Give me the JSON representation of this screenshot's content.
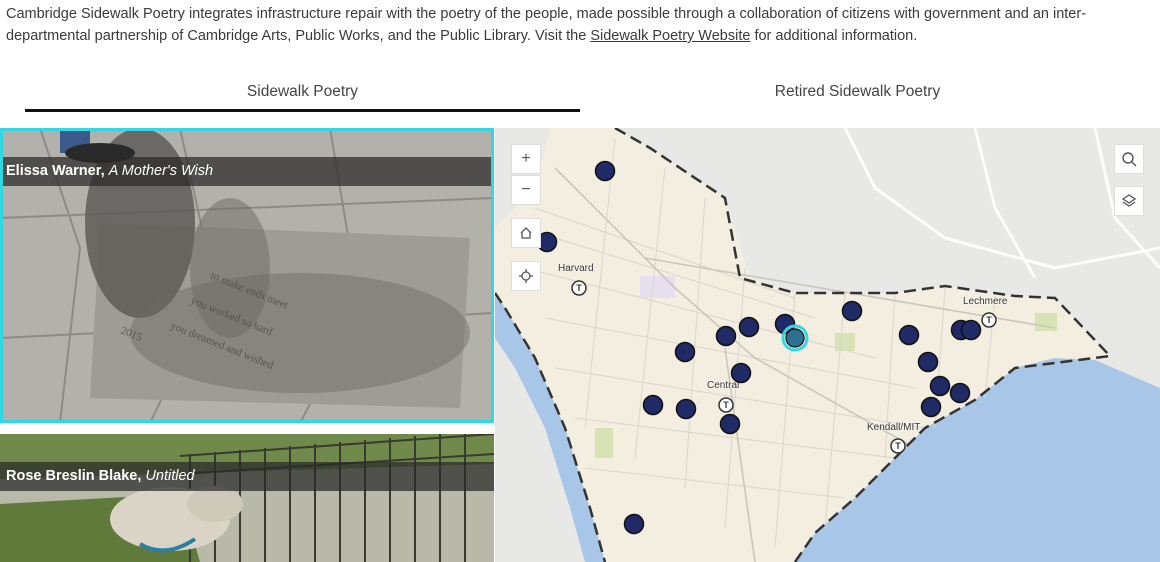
{
  "intro": {
    "text_before": "Cambridge Sidewalk Poetry integrates infrastructure repair with the poetry of the people, made possible through a collaboration of citizens with government and an inter-departmental partnership of Cambridge Arts, Public Works, and the Public Library. Visit the ",
    "link_text": "Sidewalk Poetry Website",
    "text_after": " for additional information."
  },
  "tabs": [
    {
      "label": "Sidewalk Poetry",
      "active": true
    },
    {
      "label": "Retired Sidewalk Poetry",
      "active": false
    }
  ],
  "cards": [
    {
      "author": "Elissa Warner,",
      "title": "A Mother's Wish",
      "selected": true
    },
    {
      "author": "Rose Breslin Blake,",
      "title": "Untitled",
      "selected": false
    }
  ],
  "map": {
    "controls": {
      "zoom_in": "+",
      "zoom_out": "−",
      "home": "home-icon",
      "locate": "locate-icon",
      "search": "search-icon",
      "layers": "layers-icon"
    },
    "labels": {
      "harvard": "Harvard",
      "central": "Central",
      "kendall": "Kendall/MIT",
      "lechmere": "Lechmere"
    },
    "colors": {
      "marker": "#1f2a66",
      "marker_selected": "#2f6f8f",
      "selected_ring": "#33d7e4",
      "water": "#a8c7e8",
      "land": "#f3eee0",
      "park": "#d7e3b5"
    }
  }
}
